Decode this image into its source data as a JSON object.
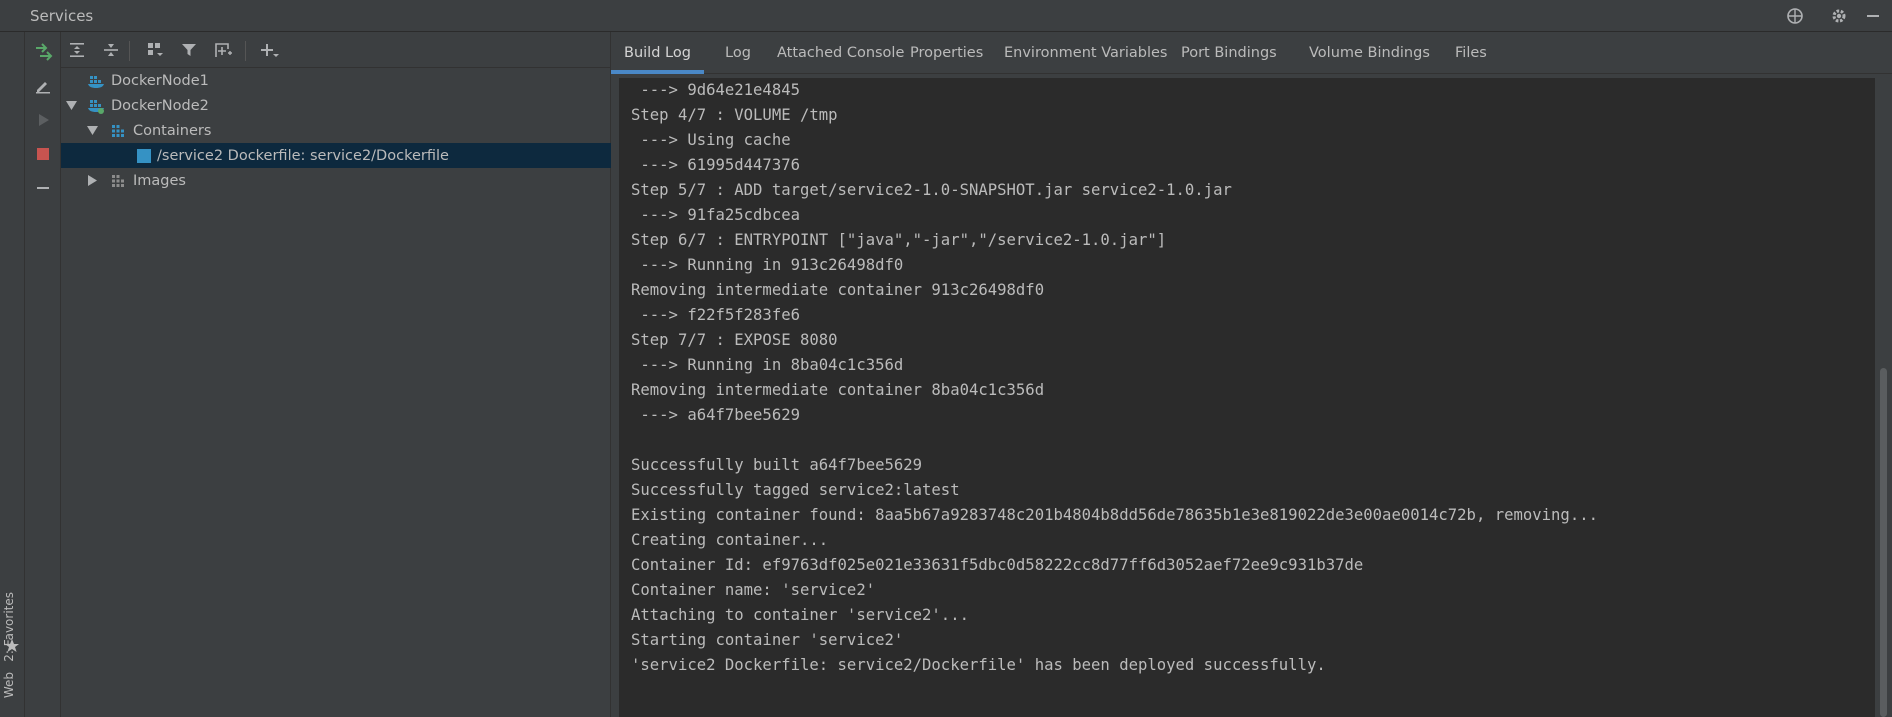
{
  "window": {
    "title": "Services",
    "icons": [
      "globe-icon",
      "gear-icon",
      "minimize-icon"
    ]
  },
  "left_strip": {
    "favorites_label": "2: Favorites",
    "web_label": "Web"
  },
  "action_bar": {
    "icons": [
      "deploy-icon",
      "edit-icon",
      "run-icon",
      "stop-icon",
      "remove-icon"
    ]
  },
  "tree_toolbar": {
    "icons": [
      "expand-all-icon",
      "collapse-all-icon",
      "group-by-icon",
      "filter-icon",
      "new-service-icon",
      "add-icon"
    ]
  },
  "tree": {
    "items": [
      {
        "label": "DockerNode1",
        "icon": "docker-icon",
        "expanded": null
      },
      {
        "label": "DockerNode2",
        "icon": "docker-connected-icon",
        "expanded": true
      },
      {
        "label": "Containers",
        "icon": "containers-icon",
        "expanded": true
      },
      {
        "label": "/service2 Dockerfile: service2/Dockerfile",
        "icon": "container-icon",
        "selected": true
      },
      {
        "label": "Images",
        "icon": "images-icon",
        "expanded": false
      }
    ]
  },
  "tabs": [
    {
      "label": "Build Log",
      "active": true
    },
    {
      "label": "Log"
    },
    {
      "label": "Attached Console"
    },
    {
      "label": "Properties"
    },
    {
      "label": "Environment Variables"
    },
    {
      "label": "Port Bindings"
    },
    {
      "label": "Volume Bindings"
    },
    {
      "label": "Files"
    }
  ],
  "log_lines": [
    " ---> 9d64e21e4845",
    "Step 4/7 : VOLUME /tmp",
    " ---> Using cache",
    " ---> 61995d447376",
    "Step 5/7 : ADD target/service2-1.0-SNAPSHOT.jar service2-1.0.jar",
    " ---> 91fa25cdbcea",
    "Step 6/7 : ENTRYPOINT [\"java\",\"-jar\",\"/service2-1.0.jar\"]",
    " ---> Running in 913c26498df0",
    "Removing intermediate container 913c26498df0",
    " ---> f22f5f283fe6",
    "Step 7/7 : EXPOSE 8080",
    " ---> Running in 8ba04c1c356d",
    "Removing intermediate container 8ba04c1c356d",
    " ---> a64f7bee5629",
    "",
    "Successfully built a64f7bee5629",
    "Successfully tagged service2:latest",
    "Existing container found: 8aa5b67a9283748c201b4804b8dd56de78635b1e3e819022de3e00ae0014c72b, removing...",
    "Creating container...",
    "Container Id: ef9763df025e021e33631f5dbc0d58222cc8d77ff6d3052aef72ee9c931b37de",
    "Container name: 'service2'",
    "Attaching to container 'service2'...",
    "Starting container 'service2'",
    "'service2 Dockerfile: service2/Dockerfile' has been deployed successfully."
  ],
  "colors": {
    "accent": "#4a88c7",
    "selection": "#0d293e",
    "run_green": "#59a869",
    "stop_red": "#c75450",
    "docker_blue": "#3592c4"
  }
}
